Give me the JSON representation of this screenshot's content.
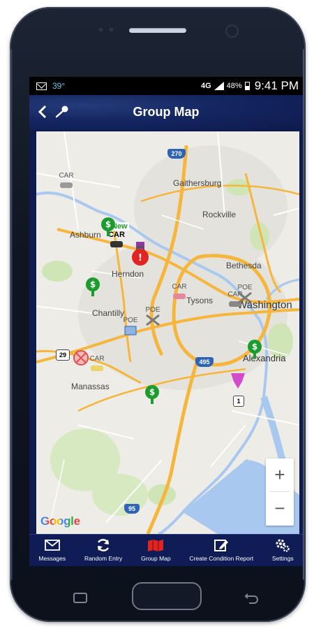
{
  "status_bar": {
    "temperature": "39°",
    "network": "4G",
    "battery": "48%",
    "time": "9:41 PM"
  },
  "app_bar": {
    "title": "Group Map",
    "back_icon": "chevron-left-icon",
    "mic_icon": "microphone-icon"
  },
  "map": {
    "places": {
      "gaithersburg": "Gaithersburg",
      "rockville": "Rockville",
      "ashburn": "Ashburn",
      "herndon": "Herndon",
      "bethesda": "Bethesda",
      "tysons": "Tysons",
      "washington": "Washington",
      "chantilly": "Chantilly",
      "alexandria": "Alexandria",
      "manassas": "Manassas"
    },
    "highway_shields": {
      "i270": "270",
      "i495": "495",
      "i95": "95",
      "us29": "29",
      "us1": "1"
    },
    "markers": {
      "car": "CAR",
      "poe": "POE",
      "new": "New"
    },
    "attribution": "Google",
    "zoom_in": "+",
    "zoom_out": "−",
    "colors": {
      "land": "#eeece6",
      "water": "#a9c8f0",
      "highway": "#f6b53b",
      "park": "#cfe5b6",
      "urban": "#e3e1da"
    }
  },
  "bottom_nav": {
    "items": [
      {
        "label": "Messages",
        "icon": "envelope-icon"
      },
      {
        "label": "Random Entry",
        "icon": "refresh-icon"
      },
      {
        "label": "Group Map",
        "icon": "map-icon"
      },
      {
        "label": "Create Condition Report",
        "icon": "edit-icon"
      },
      {
        "label": "Settings",
        "icon": "gear-icon"
      }
    ],
    "active_color": "#e02424"
  }
}
